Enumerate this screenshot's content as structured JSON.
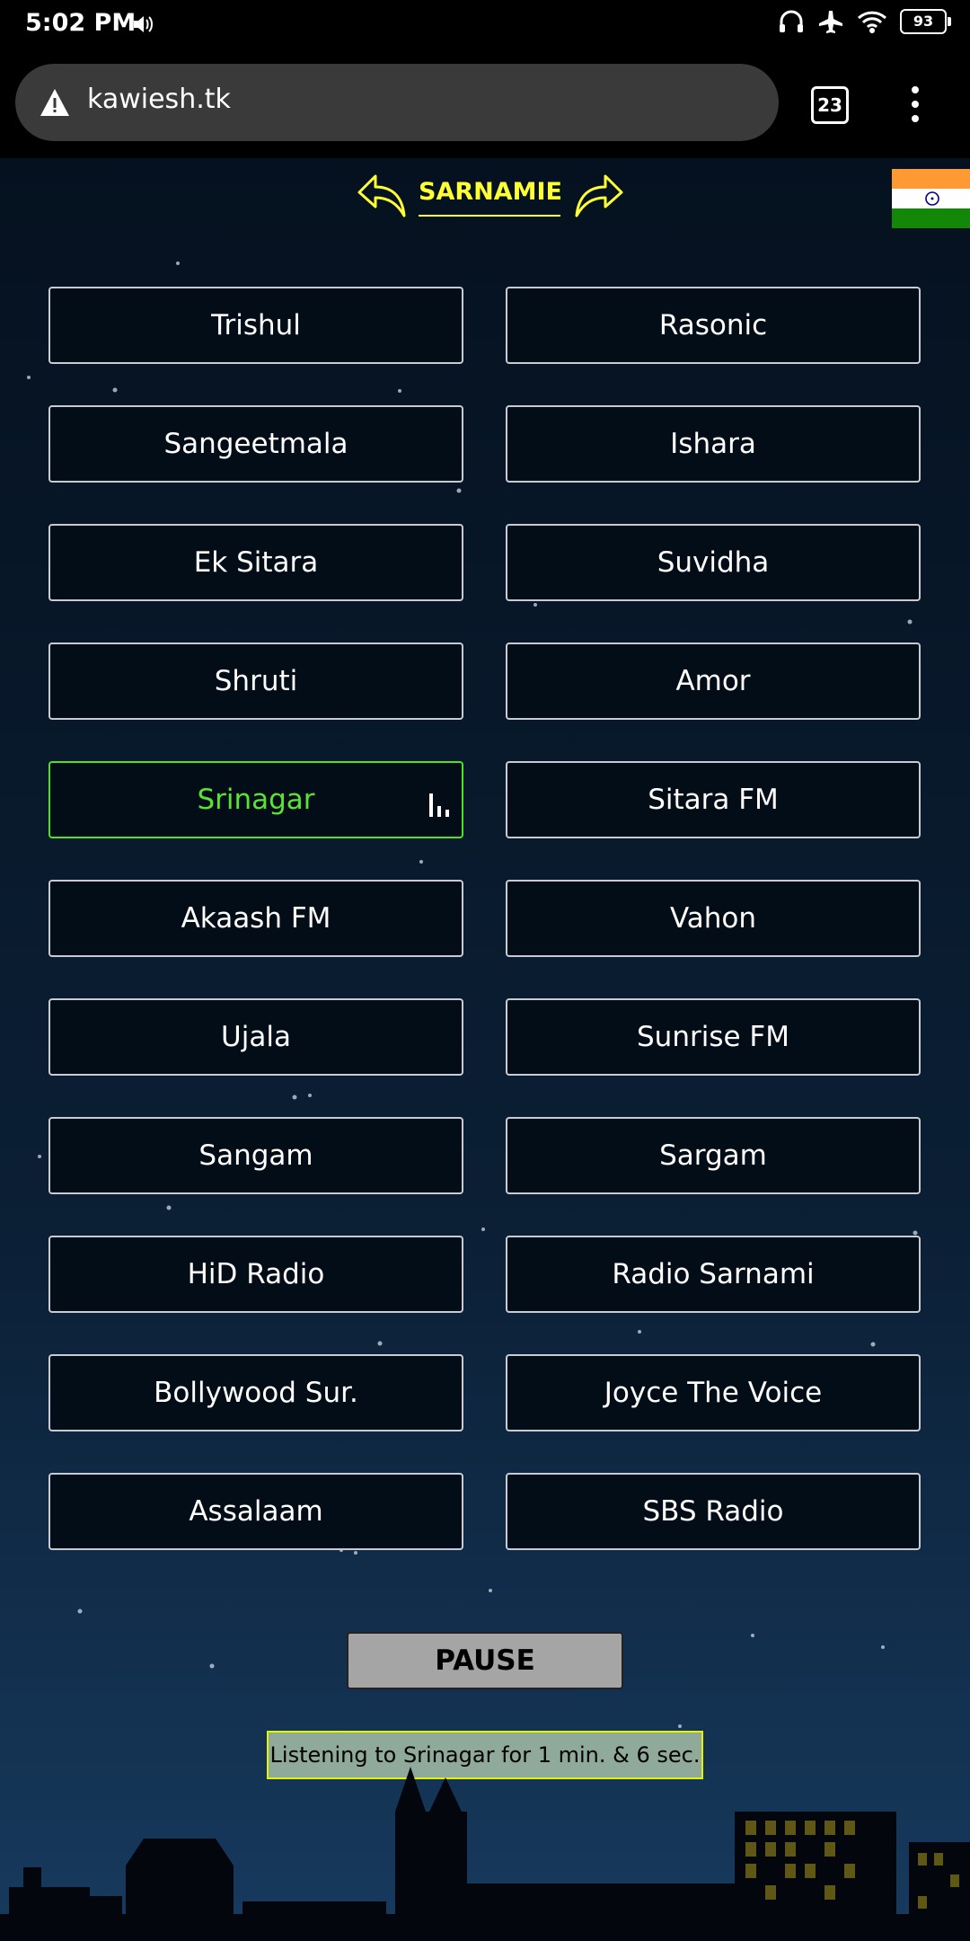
{
  "status_bar": {
    "time": "5:02 PM",
    "battery": "93",
    "icons": [
      "speaker-icon",
      "headphones-icon",
      "airplane-icon",
      "wifi-icon",
      "battery-icon"
    ]
  },
  "browser": {
    "url": "kawiesh.tk",
    "tab_count": "23",
    "icons": [
      "warning-icon",
      "menu-icon"
    ]
  },
  "page": {
    "category_title": "SARNAMIE",
    "flag": "india-flag",
    "stations": [
      {
        "name": "Trishul",
        "active": false
      },
      {
        "name": "Rasonic",
        "active": false
      },
      {
        "name": "Sangeetmala",
        "active": false
      },
      {
        "name": "Ishara",
        "active": false
      },
      {
        "name": "Ek Sitara",
        "active": false
      },
      {
        "name": "Suvidha",
        "active": false
      },
      {
        "name": "Shruti",
        "active": false
      },
      {
        "name": "Amor",
        "active": false
      },
      {
        "name": "Srinagar",
        "active": true
      },
      {
        "name": "Sitara FM",
        "active": false
      },
      {
        "name": "Akaash FM",
        "active": false
      },
      {
        "name": "Vahon",
        "active": false
      },
      {
        "name": "Ujala",
        "active": false
      },
      {
        "name": "Sunrise FM",
        "active": false
      },
      {
        "name": "Sangam",
        "active": false
      },
      {
        "name": "Sargam",
        "active": false
      },
      {
        "name": "HiD Radio",
        "active": false
      },
      {
        "name": "Radio Sarnami",
        "active": false
      },
      {
        "name": "Bollywood Sur.",
        "active": false
      },
      {
        "name": "Joyce The Voice",
        "active": false
      },
      {
        "name": "Assalaam",
        "active": false
      },
      {
        "name": "SBS Radio",
        "active": false
      }
    ],
    "pause_label": "PAUSE",
    "listening_text": "Listening to Srinagar for 1 min. & 6 sec."
  },
  "colors": {
    "accent": "#ffff33",
    "active_station": "#5be236",
    "background_top": "#05111f",
    "background_bottom": "#173a5e"
  }
}
